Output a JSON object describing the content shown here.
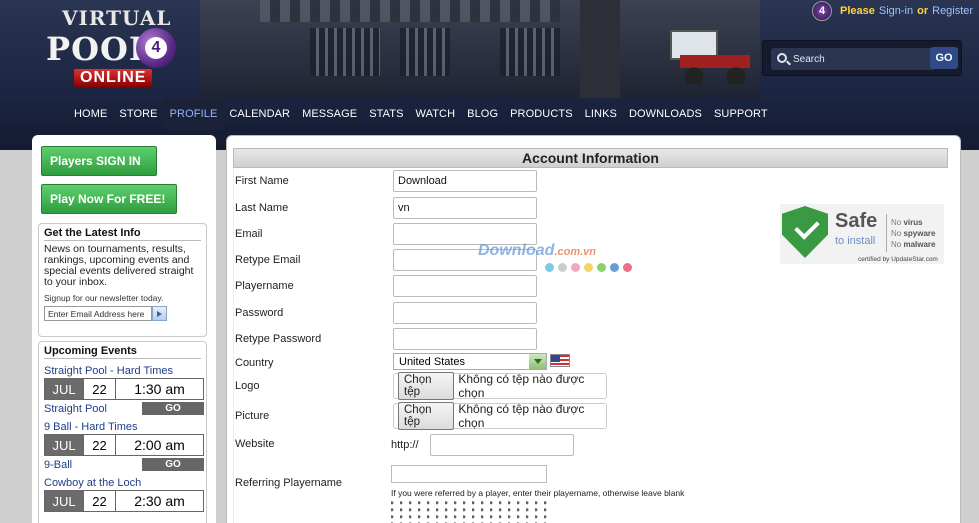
{
  "header": {
    "logo": {
      "line1": "VIRTUAL",
      "line2": "POOL",
      "number": "4",
      "line3": "ONLINE"
    },
    "signin": {
      "please": "Please",
      "sign_in": "Sign-in",
      "or": "or",
      "register": "Register"
    },
    "search": {
      "placeholder": "Search",
      "go": "GO"
    }
  },
  "nav": [
    "HOME",
    "STORE",
    "PROFILE",
    "CALENDAR",
    "MESSAGE",
    "STATS",
    "WATCH",
    "BLOG",
    "PRODUCTS",
    "LINKS",
    "DOWNLOADS",
    "SUPPORT"
  ],
  "nav_active": "PROFILE",
  "sidebar": {
    "signin_button": "Players SIGN IN",
    "play_button": "Play Now For FREE!",
    "latest": {
      "title": "Get the Latest Info",
      "text": "News on tournaments, results, rankings, upcoming events and special events delivered straight to your inbox.",
      "signup": "Signup for our newsletter today.",
      "email_placeholder": "Enter Email Address here"
    },
    "events_title": "Upcoming Events",
    "events": [
      {
        "title": "Straight Pool - Hard Times",
        "month": "JUL",
        "day": "22",
        "time": "1:30 am",
        "type": "Straight Pool",
        "go": "GO"
      },
      {
        "title": "9 Ball - Hard Times",
        "month": "JUL",
        "day": "22",
        "time": "2:00 am",
        "type": "9-Ball",
        "go": "GO"
      },
      {
        "title": "Cowboy at the Loch",
        "month": "JUL",
        "day": "22",
        "time": "2:30 am"
      }
    ]
  },
  "form": {
    "title": "Account Information",
    "labels": {
      "first_name": "First Name",
      "last_name": "Last Name",
      "email": "Email",
      "retype_email": "Retype Email",
      "playername": "Playername",
      "password": "Password",
      "retype_password": "Retype Password",
      "country": "Country",
      "logo": "Logo",
      "picture": "Picture",
      "website": "Website",
      "referring": "Referring Playername"
    },
    "values": {
      "first_name": "Download",
      "last_name": "vn",
      "country": "United States",
      "http": "http://"
    },
    "file": {
      "button": "Chọn tệp",
      "none": "Không có tệp nào được chọn"
    },
    "ref_hint": "If you were referred by a player, enter their playername, otherwise leave blank"
  },
  "badge": {
    "safe": "Safe",
    "install": "to install",
    "no_virus": "No virus",
    "no_spyware": "No spyware",
    "no_malware": "No malware",
    "no": "No",
    "virus": "virus",
    "spyware": "spyware",
    "malware": "malware",
    "certified": "certified by UpdateStar.com"
  },
  "watermark": {
    "text": "Download",
    "domain": ".com.vn"
  },
  "colors": {
    "header_bg": "#1d2744",
    "nav_active": "#8fb4ff",
    "green_button": "#3fae4f",
    "dots": [
      "#7ec8e8",
      "#cccccc",
      "#f0a8c0",
      "#f2d46a",
      "#8cd06a",
      "#6a9cd8",
      "#e8708a"
    ]
  }
}
